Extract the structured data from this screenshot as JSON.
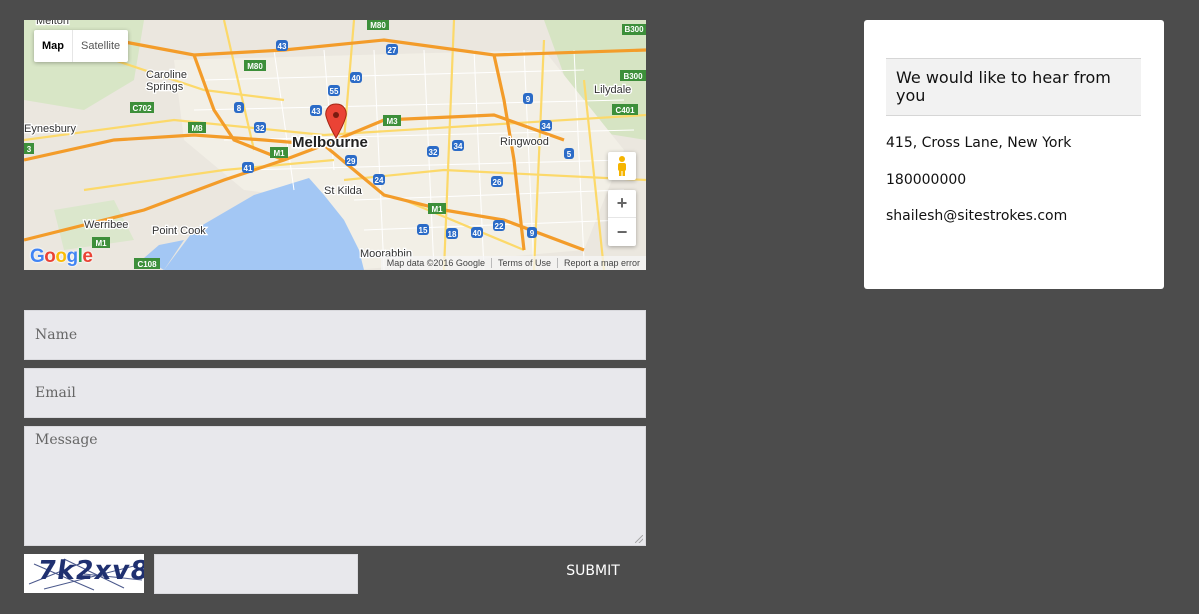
{
  "map": {
    "type_controls": {
      "map_label": "Map",
      "satellite_label": "Satellite"
    },
    "city_label": "Melbourne",
    "place_labels": [
      "Melton",
      "Caroline Springs",
      "Eynesbury",
      "Werribee",
      "Point Cook",
      "St Kilda",
      "Ringwood",
      "Lilydale",
      "Moorabbin"
    ],
    "road_shields": [
      "M80",
      "43",
      "27",
      "40",
      "55",
      "8",
      "32",
      "43",
      "M3",
      "9",
      "34",
      "M1",
      "32",
      "34",
      "41",
      "29",
      "24",
      "26",
      "5",
      "M1",
      "15",
      "18",
      "40",
      "22",
      "9",
      "M8",
      "C702",
      "C401",
      "B300",
      "C108",
      "M1"
    ],
    "zoom_in_label": "+",
    "zoom_out_label": "−",
    "logo_letters": [
      "G",
      "o",
      "o",
      "g",
      "l",
      "e"
    ],
    "logo_colors": [
      "#4285f4",
      "#ea4335",
      "#fbbc05",
      "#4285f4",
      "#34a853",
      "#ea4335"
    ],
    "footer": {
      "map_data": "Map data ©2016 Google",
      "terms": "Terms of Use",
      "report": "Report a map error"
    }
  },
  "form": {
    "name_placeholder": "Name",
    "email_placeholder": "Email",
    "message_placeholder": "Message",
    "captcha_text": "7k2xv8",
    "submit_label": "SUBMIT"
  },
  "contact": {
    "title": "We would like to hear from you",
    "address": "415, Cross Lane, New York",
    "phone": "180000000",
    "email": "shailesh@sitestrokes.com"
  }
}
